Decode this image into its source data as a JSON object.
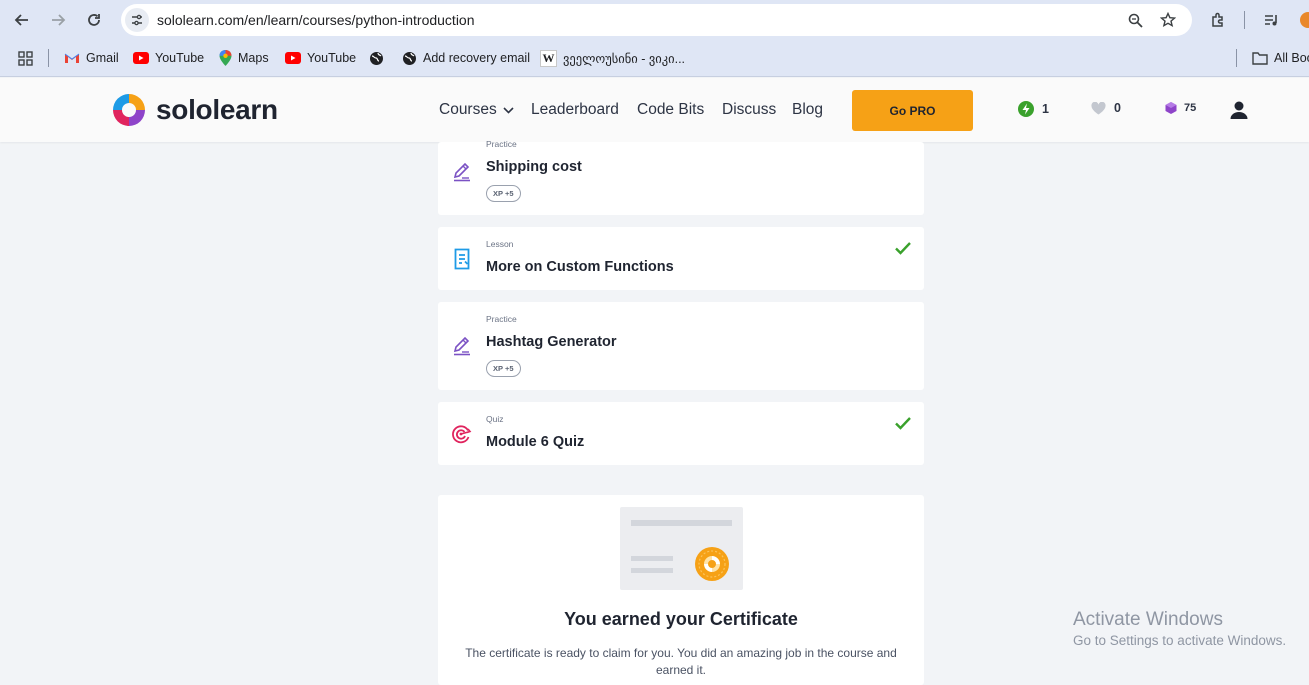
{
  "browser": {
    "url": "sololearn.com/en/learn/courses/python-introduction",
    "bookmarks": {
      "gmail": "Gmail",
      "youtube1": "YouTube",
      "maps": "Maps",
      "youtube2": "YouTube",
      "recovery": "Add recovery email",
      "wiki": "ვეელოუსინი - ვიკი...",
      "all_bookmarks": "All Boo"
    }
  },
  "header": {
    "logo": "sololearn",
    "nav": {
      "courses": "Courses",
      "leaderboard": "Leaderboard",
      "code_bits": "Code Bits",
      "discuss": "Discuss",
      "blog": "Blog"
    },
    "go_pro": "Go PRO",
    "streak": "1",
    "hearts": "0",
    "gems": "75"
  },
  "items": [
    {
      "type": "Practice",
      "title": "Shipping cost",
      "xp": "XP +5",
      "completed": false
    },
    {
      "type": "Lesson",
      "title": "More on Custom Functions",
      "completed": true
    },
    {
      "type": "Practice",
      "title": "Hashtag Generator",
      "xp": "XP +5",
      "completed": false
    },
    {
      "type": "Quiz",
      "title": "Module 6 Quiz",
      "completed": true
    }
  ],
  "certificate": {
    "title": "You earned your Certificate",
    "description": "The certificate is ready to claim for you. You did an amazing job in the course and earned it."
  },
  "watermark": {
    "line1": "Activate Windows",
    "line2": "Go to Settings to activate Windows."
  },
  "colors": {
    "accent": "#f6a116",
    "check": "#3aa12c",
    "practice_icon": "#7b52c4",
    "lesson_icon": "#1e9be6",
    "quiz_icon": "#e0245e"
  }
}
